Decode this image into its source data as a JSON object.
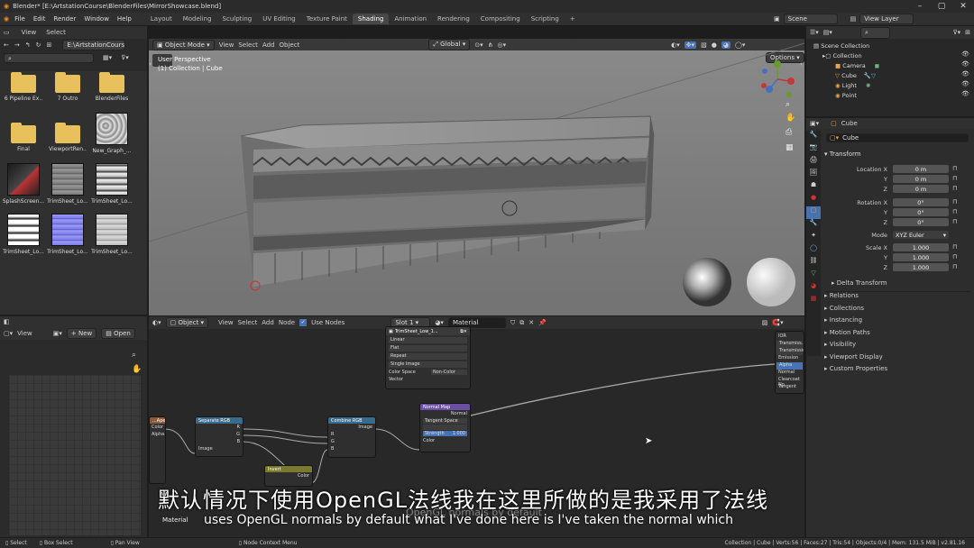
{
  "window": {
    "title": "Blender* [E:\\ArtstationCourse\\BlenderFiles\\MirrorShowcase.blend]"
  },
  "menu": [
    "File",
    "Edit",
    "Render",
    "Window",
    "Help"
  ],
  "workspace_tabs": [
    "Layout",
    "Modeling",
    "Sculpting",
    "UV Editing",
    "Texture Paint",
    "Shading",
    "Animation",
    "Rendering",
    "Compositing",
    "Scripting"
  ],
  "active_tab": "Shading",
  "scene": {
    "name": "Scene",
    "view_layer": "View Layer"
  },
  "file_browser": {
    "view_label": "View",
    "select_label": "Select",
    "path": "E:\\ArtstationCourse\\",
    "items": [
      {
        "label": "6 Pipeline Ex..",
        "kind": "folder"
      },
      {
        "label": "7 Outro",
        "kind": "folder"
      },
      {
        "label": "BlenderFiles",
        "kind": "folder"
      },
      {
        "label": "Final",
        "kind": "folder"
      },
      {
        "label": "ViewportRen..",
        "kind": "folder"
      },
      {
        "label": "New_Graph_...",
        "kind": "image"
      },
      {
        "label": "SplashScreen...",
        "kind": "image"
      },
      {
        "label": "TrimSheet_Lo...",
        "kind": "image"
      },
      {
        "label": "TrimSheet_Lo...",
        "kind": "image"
      },
      {
        "label": "TrimSheet_Lo...",
        "kind": "image"
      },
      {
        "label": "TrimSheet_Lo...",
        "kind": "image"
      },
      {
        "label": "TrimSheet_Lo...",
        "kind": "image"
      }
    ]
  },
  "image_editor": {
    "view_label": "View",
    "new_label": "New",
    "open_label": "Open"
  },
  "viewport": {
    "mode": "Object Mode",
    "menus": [
      "View",
      "Select",
      "Add",
      "Object"
    ],
    "orientation": "Global",
    "options_label": "Options",
    "overlay_line1": "User Perspective",
    "overlay_line2": "(1) Collection | Cube"
  },
  "outliner": {
    "rows": [
      {
        "label": "Scene Collection"
      },
      {
        "label": "Collection"
      },
      {
        "label": "Camera"
      },
      {
        "label": "Cube"
      },
      {
        "label": "Light"
      },
      {
        "label": "Point"
      }
    ]
  },
  "properties": {
    "object_name": "Cube",
    "data_name": "Cube",
    "transform_label": "Transform",
    "location_label": "Location X",
    "rotation_label": "Rotation X",
    "mode_label": "Mode",
    "scale_label": "Scale X",
    "axis_y": "Y",
    "axis_z": "Z",
    "location": [
      "0 m",
      "0 m",
      "0 m"
    ],
    "rotation": [
      "0°",
      "0°",
      "0°"
    ],
    "mode": "XYZ Euler",
    "scale": [
      "1.000",
      "1.000",
      "1.000"
    ],
    "delta_transform": "Delta Transform",
    "sections": [
      "Relations",
      "Collections",
      "Instancing",
      "Motion Paths",
      "Visibility",
      "Viewport Display",
      "Custom Properties"
    ]
  },
  "node_editor": {
    "object_label": "Object",
    "menus": [
      "View",
      "Select",
      "Add",
      "Node"
    ],
    "use_nodes_label": "Use Nodes",
    "slot": "Slot 1",
    "material": "Material",
    "footer_label": "Material",
    "image_node": {
      "title": "TrimSheet_Low_1...",
      "rows": [
        "Linear",
        "Flat",
        "Repeat",
        "Single Image",
        "Color Space",
        "Non-Color",
        "Vector"
      ]
    },
    "separate_rgb": {
      "title": "Separate RGB",
      "outputs": [
        "R",
        "G",
        "B"
      ],
      "input": "Image"
    },
    "combine_rgb": {
      "title": "Combine RGB",
      "inputs": [
        "R",
        "G",
        "B"
      ],
      "output": "Image"
    },
    "normal_map": {
      "title": "Normal Map",
      "output": "Normal",
      "space": "Tangent Space",
      "strength_label": "Strength",
      "strength": "1.000",
      "input": "Color"
    },
    "invert": {
      "title": "Invert",
      "output": "Color"
    },
    "left_node": {
      "title": "...Ape",
      "rows": [
        "Color",
        "Alpha"
      ]
    },
    "principled_rows": [
      "IOR",
      "Transmiss..R",
      "Transmissio..",
      "Emission",
      "Alpha",
      "Normal",
      "Clearcoat No..",
      "Tangent"
    ]
  },
  "subtitles": {
    "cn": "默认情况下使用OpenGL法线我在这里所做的是我采用了法线",
    "en": "uses OpenGL normals by default what I've done here is I've taken the normal which",
    "ghost": "OpenGL normals by default"
  },
  "status_bar": {
    "select": "Select",
    "box_select": "Box Select",
    "pan_view": "Pan View",
    "context_menu": "Node Context Menu",
    "stats": "Collection | Cube | Verts:56 | Faces:27 | Tris:54 | Objects:0/4 | Mem: 131.5 MiB | v2.81.16"
  },
  "colors": {
    "accent": "#4772b3",
    "folder": "#e8c15c",
    "node_image": "#8a5a3a",
    "node_converter": "#3a6a8c",
    "node_vector": "#6b4fa3",
    "node_color": "#7a7a2e"
  }
}
